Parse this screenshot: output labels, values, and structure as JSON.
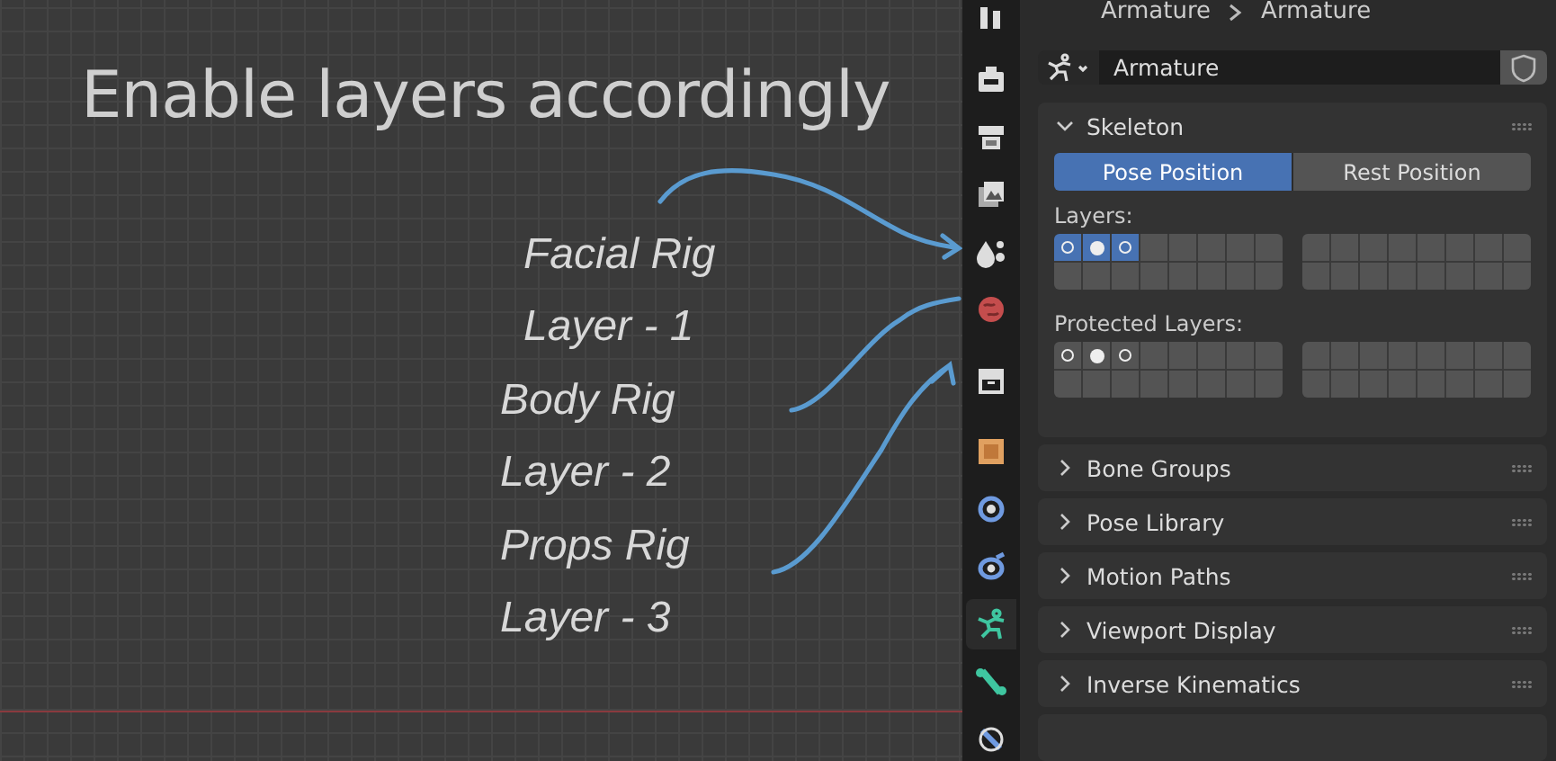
{
  "viewport": {
    "title": "Enable layers accordingly",
    "labels": [
      "Facial Rig",
      "Layer - 1",
      "Body Rig",
      "Layer - 2",
      "Props Rig",
      "Layer - 3"
    ]
  },
  "header": {
    "path": [
      "Armature",
      "Armature"
    ]
  },
  "datablock": {
    "name": "Armature"
  },
  "property_tabs": [
    {
      "selected": false
    },
    {
      "selected": false
    },
    {
      "selected": false
    },
    {
      "selected": false
    },
    {
      "selected": false
    },
    {
      "selected": false
    },
    {
      "selected": false
    },
    {
      "selected": false
    },
    {
      "selected": false
    },
    {
      "selected": false
    },
    {
      "selected": true
    },
    {
      "selected": false
    },
    {
      "selected": false
    }
  ],
  "skeleton": {
    "title": "Skeleton",
    "expanded": true,
    "pose_buttons": [
      {
        "label": "Pose Position",
        "selected": true
      },
      {
        "label": "Rest Position",
        "selected": false
      }
    ],
    "layers": {
      "label": "Layers:",
      "blocks": [
        {
          "cells": [
            {
              "selected": true,
              "kind": "ring"
            },
            {
              "selected": true,
              "kind": "dot"
            },
            {
              "selected": true,
              "kind": "ring"
            },
            {
              "selected": false,
              "kind": "none"
            },
            {
              "selected": false,
              "kind": "none"
            },
            {
              "selected": false,
              "kind": "none"
            },
            {
              "selected": false,
              "kind": "none"
            },
            {
              "selected": false,
              "kind": "none"
            },
            {
              "selected": false,
              "kind": "none"
            },
            {
              "selected": false,
              "kind": "none"
            },
            {
              "selected": false,
              "kind": "none"
            },
            {
              "selected": false,
              "kind": "none"
            },
            {
              "selected": false,
              "kind": "none"
            },
            {
              "selected": false,
              "kind": "none"
            },
            {
              "selected": false,
              "kind": "none"
            },
            {
              "selected": false,
              "kind": "none"
            }
          ]
        },
        {
          "cells": [
            {
              "selected": false,
              "kind": "none"
            },
            {
              "selected": false,
              "kind": "none"
            },
            {
              "selected": false,
              "kind": "none"
            },
            {
              "selected": false,
              "kind": "none"
            },
            {
              "selected": false,
              "kind": "none"
            },
            {
              "selected": false,
              "kind": "none"
            },
            {
              "selected": false,
              "kind": "none"
            },
            {
              "selected": false,
              "kind": "none"
            },
            {
              "selected": false,
              "kind": "none"
            },
            {
              "selected": false,
              "kind": "none"
            },
            {
              "selected": false,
              "kind": "none"
            },
            {
              "selected": false,
              "kind": "none"
            },
            {
              "selected": false,
              "kind": "none"
            },
            {
              "selected": false,
              "kind": "none"
            },
            {
              "selected": false,
              "kind": "none"
            },
            {
              "selected": false,
              "kind": "none"
            }
          ]
        }
      ]
    },
    "protected_layers": {
      "label": "Protected Layers:",
      "blocks": [
        {
          "cells": [
            {
              "selected": false,
              "kind": "ring"
            },
            {
              "selected": false,
              "kind": "dot"
            },
            {
              "selected": false,
              "kind": "ring"
            },
            {
              "selected": false,
              "kind": "none"
            },
            {
              "selected": false,
              "kind": "none"
            },
            {
              "selected": false,
              "kind": "none"
            },
            {
              "selected": false,
              "kind": "none"
            },
            {
              "selected": false,
              "kind": "none"
            },
            {
              "selected": false,
              "kind": "none"
            },
            {
              "selected": false,
              "kind": "none"
            },
            {
              "selected": false,
              "kind": "none"
            },
            {
              "selected": false,
              "kind": "none"
            },
            {
              "selected": false,
              "kind": "none"
            },
            {
              "selected": false,
              "kind": "none"
            },
            {
              "selected": false,
              "kind": "none"
            },
            {
              "selected": false,
              "kind": "none"
            }
          ]
        },
        {
          "cells": [
            {
              "selected": false,
              "kind": "none"
            },
            {
              "selected": false,
              "kind": "none"
            },
            {
              "selected": false,
              "kind": "none"
            },
            {
              "selected": false,
              "kind": "none"
            },
            {
              "selected": false,
              "kind": "none"
            },
            {
              "selected": false,
              "kind": "none"
            },
            {
              "selected": false,
              "kind": "none"
            },
            {
              "selected": false,
              "kind": "none"
            },
            {
              "selected": false,
              "kind": "none"
            },
            {
              "selected": false,
              "kind": "none"
            },
            {
              "selected": false,
              "kind": "none"
            },
            {
              "selected": false,
              "kind": "none"
            },
            {
              "selected": false,
              "kind": "none"
            },
            {
              "selected": false,
              "kind": "none"
            },
            {
              "selected": false,
              "kind": "none"
            },
            {
              "selected": false,
              "kind": "none"
            }
          ]
        }
      ]
    }
  },
  "panels": [
    {
      "title": "Bone Groups",
      "expanded": false
    },
    {
      "title": "Pose Library",
      "expanded": false
    },
    {
      "title": "Motion Paths",
      "expanded": false
    },
    {
      "title": "Viewport Display",
      "expanded": false
    },
    {
      "title": "Inverse Kinematics",
      "expanded": false
    }
  ]
}
